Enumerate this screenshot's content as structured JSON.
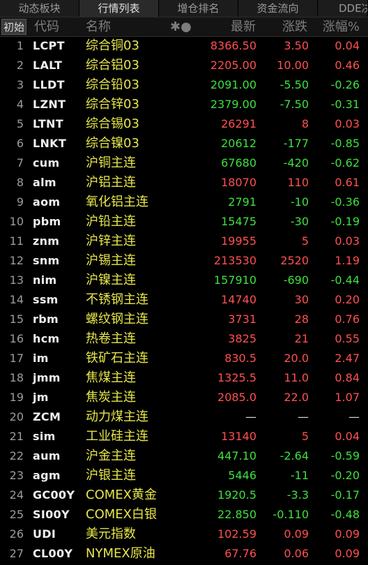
{
  "tabs": [
    "动态板块",
    "行情列表",
    "增仓排名",
    "资金流向",
    "DDE决策"
  ],
  "header": {
    "init_label": "初始",
    "code": "代码",
    "name": "名称",
    "icons": "✱●",
    "latest": "最新",
    "change": "涨跌",
    "change_pct": "涨幅%"
  },
  "colors": {
    "up": "#ff5050",
    "down": "#3ee03e",
    "flat": "#dcdcdc",
    "name": "#e6e64b"
  },
  "rows": [
    {
      "idx": "1",
      "code": "LCPT",
      "name": "综合铜03",
      "latest": "8366.50",
      "change": "3.50",
      "pct": "0.04",
      "dir": "up"
    },
    {
      "idx": "2",
      "code": "LALT",
      "name": "综合铝03",
      "latest": "2205.00",
      "change": "10.00",
      "pct": "0.46",
      "dir": "up"
    },
    {
      "idx": "3",
      "code": "LLDT",
      "name": "综合铅03",
      "latest": "2091.00",
      "change": "-5.50",
      "pct": "-0.26",
      "dir": "down"
    },
    {
      "idx": "4",
      "code": "LZNT",
      "name": "综合锌03",
      "latest": "2379.00",
      "change": "-7.50",
      "pct": "-0.31",
      "dir": "down"
    },
    {
      "idx": "5",
      "code": "LTNT",
      "name": "综合锡03",
      "latest": "26291",
      "change": "8",
      "pct": "0.03",
      "dir": "up"
    },
    {
      "idx": "6",
      "code": "LNKT",
      "name": "综合镍03",
      "latest": "20612",
      "change": "-177",
      "pct": "-0.85",
      "dir": "down"
    },
    {
      "idx": "7",
      "code": "cum",
      "name": "沪铜主连",
      "latest": "67680",
      "change": "-420",
      "pct": "-0.62",
      "dir": "down"
    },
    {
      "idx": "8",
      "code": "alm",
      "name": "沪铝主连",
      "latest": "18070",
      "change": "110",
      "pct": "0.61",
      "dir": "up"
    },
    {
      "idx": "9",
      "code": "aom",
      "name": "氧化铝主连",
      "latest": "2791",
      "change": "-10",
      "pct": "-0.36",
      "dir": "down"
    },
    {
      "idx": "10",
      "code": "pbm",
      "name": "沪铅主连",
      "latest": "15475",
      "change": "-30",
      "pct": "-0.19",
      "dir": "down"
    },
    {
      "idx": "11",
      "code": "znm",
      "name": "沪锌主连",
      "latest": "19955",
      "change": "5",
      "pct": "0.03",
      "dir": "up"
    },
    {
      "idx": "12",
      "code": "snm",
      "name": "沪锡主连",
      "latest": "213530",
      "change": "2520",
      "pct": "1.19",
      "dir": "up"
    },
    {
      "idx": "13",
      "code": "nim",
      "name": "沪镍主连",
      "latest": "157910",
      "change": "-690",
      "pct": "-0.44",
      "dir": "down"
    },
    {
      "idx": "14",
      "code": "ssm",
      "name": "不锈钢主连",
      "latest": "14740",
      "change": "30",
      "pct": "0.20",
      "dir": "up"
    },
    {
      "idx": "15",
      "code": "rbm",
      "name": "螺纹钢主连",
      "latest": "3731",
      "change": "28",
      "pct": "0.76",
      "dir": "up"
    },
    {
      "idx": "16",
      "code": "hcm",
      "name": "热卷主连",
      "latest": "3825",
      "change": "21",
      "pct": "0.55",
      "dir": "up"
    },
    {
      "idx": "17",
      "code": "im",
      "name": "铁矿石主连",
      "latest": "830.5",
      "change": "20.0",
      "pct": "2.47",
      "dir": "up"
    },
    {
      "idx": "18",
      "code": "jmm",
      "name": "焦煤主连",
      "latest": "1325.5",
      "change": "11.0",
      "pct": "0.84",
      "dir": "up"
    },
    {
      "idx": "19",
      "code": "jm",
      "name": "焦炭主连",
      "latest": "2085.0",
      "change": "22.0",
      "pct": "1.07",
      "dir": "up"
    },
    {
      "idx": "20",
      "code": "ZCM",
      "name": "动力煤主连",
      "latest": "—",
      "change": "—",
      "pct": "—",
      "dir": "flat"
    },
    {
      "idx": "21",
      "code": "sim",
      "name": "工业硅主连",
      "latest": "13140",
      "change": "5",
      "pct": "0.04",
      "dir": "up"
    },
    {
      "idx": "22",
      "code": "aum",
      "name": "沪金主连",
      "latest": "447.10",
      "change": "-2.64",
      "pct": "-0.59",
      "dir": "down"
    },
    {
      "idx": "23",
      "code": "agm",
      "name": "沪银主连",
      "latest": "5446",
      "change": "-11",
      "pct": "-0.20",
      "dir": "down"
    },
    {
      "idx": "24",
      "code": "GC00Y",
      "name": "COMEX黄金",
      "latest": "1920.5",
      "change": "-3.3",
      "pct": "-0.17",
      "dir": "down"
    },
    {
      "idx": "25",
      "code": "SI00Y",
      "name": "COMEX白银",
      "latest": "22.850",
      "change": "-0.110",
      "pct": "-0.48",
      "dir": "down"
    },
    {
      "idx": "26",
      "code": "UDI",
      "name": "美元指数",
      "latest": "102.59",
      "change": "0.09",
      "pct": "0.09",
      "dir": "up"
    },
    {
      "idx": "27",
      "code": "CL00Y",
      "name": "NYMEX原油",
      "latest": "67.76",
      "change": "0.06",
      "pct": "0.09",
      "dir": "up"
    }
  ]
}
